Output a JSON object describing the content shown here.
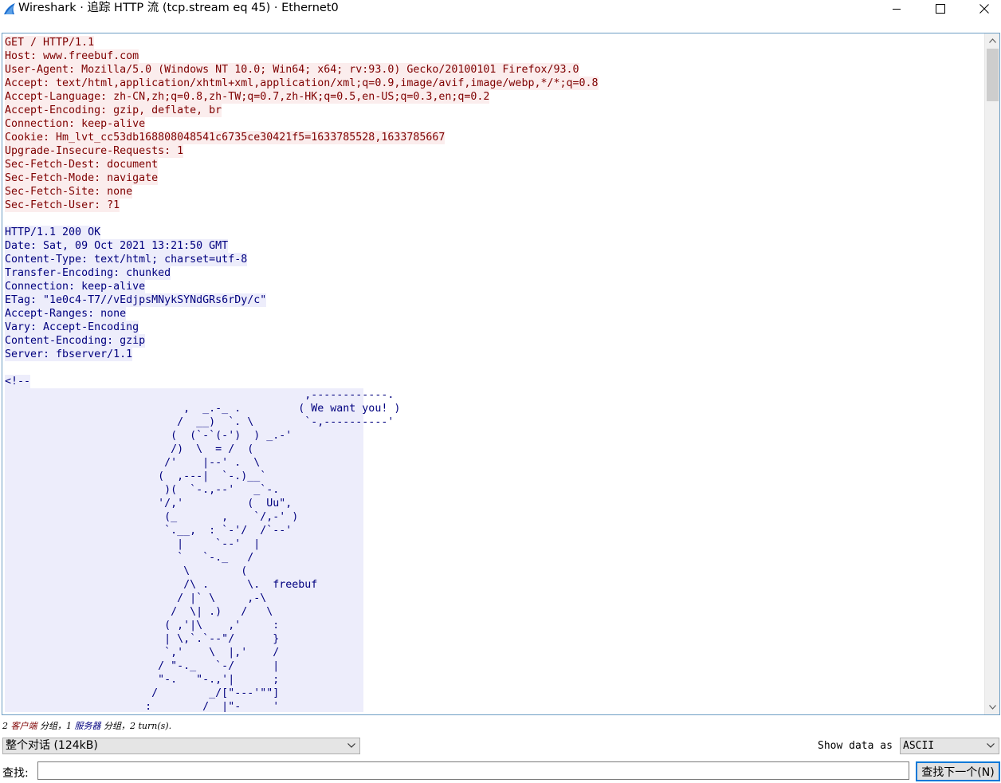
{
  "window": {
    "title": "Wireshark · 追踪 HTTP 流 (tcp.stream eq 45) · Ethernet0",
    "icon": "wireshark-fin-icon",
    "controls": [
      "minimize-icon",
      "maximize-icon",
      "close-icon"
    ]
  },
  "colors": {
    "client_bg": "#fbeded",
    "client_fg": "#7f0000",
    "server_bg": "#ededfb",
    "server_fg": "#00007f",
    "pane_border": "#6e9ec4"
  },
  "stream": {
    "client_request": [
      "GET / HTTP/1.1",
      "Host: www.freebuf.com",
      "User-Agent: Mozilla/5.0 (Windows NT 10.0; Win64; x64; rv:93.0) Gecko/20100101 Firefox/93.0",
      "Accept: text/html,application/xhtml+xml,application/xml;q=0.9,image/avif,image/webp,*/*;q=0.8",
      "Accept-Language: zh-CN,zh;q=0.8,zh-TW;q=0.7,zh-HK;q=0.5,en-US;q=0.3,en;q=0.2",
      "Accept-Encoding: gzip, deflate, br",
      "Connection: keep-alive",
      "Cookie: Hm_lvt_cc53db168808048541c6735ce30421f5=1633785528,1633785667",
      "Upgrade-Insecure-Requests: 1",
      "Sec-Fetch-Dest: document",
      "Sec-Fetch-Mode: navigate",
      "Sec-Fetch-Site: none",
      "Sec-Fetch-User: ?1"
    ],
    "server_response": [
      "HTTP/1.1 200 OK",
      "Date: Sat, 09 Oct 2021 13:21:50 GMT",
      "Content-Type: text/html; charset=utf-8",
      "Transfer-Encoding: chunked",
      "Connection: keep-alive",
      "ETag: \"1e0c4-T7//vEdjpsMNykSYNdGRs6rDy/c\"",
      "Accept-Ranges: none",
      "Vary: Accept-Encoding",
      "Content-Encoding: gzip",
      "Server: fbserver/1.1"
    ],
    "html_comment_open": "<!--",
    "ascii_art": [
      "                                               ,------------.",
      "                            ,  _.-_ .         ( We want you! )",
      "                           /  __)  `. \\        `-,----------'",
      "                          (  (`-`(-')  ) _.-'",
      "                          /)  \\  = /  (",
      "                         /'    |--' .  \\",
      "                        (  ,---|  `-.)__`",
      "                         )(  `-.,--'   _`-.",
      "                        '/,'          (  Uu\",",
      "                         (_       ,    `/,-' )",
      "                         `.__,  : `-'/  /`--'",
      "                           |     `--'  |",
      "                           `   `-._   /",
      "                            \\        (",
      "                            /\\ .      \\.  freebuf",
      "                           / |` \\     ,-\\",
      "                          /  \\| .)   /   \\",
      "                         ( ,'|\\    ,'     :",
      "                         | \\,`.`--\"/      }",
      "                         `,'    \\  |,'    /",
      "                        / \"-._   `-/      |",
      "                        \"-.   \"-.,'|      ;",
      "                       /        _/[\"---'\"\"]",
      "                      :        /  |\"-     '"
    ]
  },
  "status": {
    "prefix": "2 ",
    "client_word": "客户端",
    "middle": " 分组，1 ",
    "server_word": "服务器",
    "suffix": " 分组，2 turn(s)."
  },
  "controls": {
    "conversation_select": "整个对话 (124kB)",
    "show_data_label": "Show data as",
    "show_data_value": "ASCII",
    "find_label": "查找:",
    "find_value": "",
    "find_next_button": "查找下一个(N)"
  }
}
